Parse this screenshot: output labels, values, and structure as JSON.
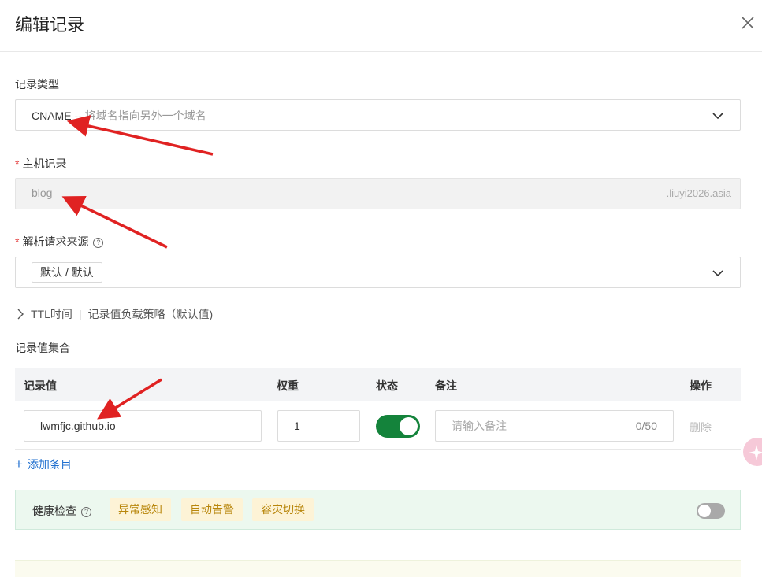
{
  "dialog": {
    "title": "编辑记录"
  },
  "record_type": {
    "label": "记录类型",
    "value": "CNAME",
    "hint": " -- 将域名指向另外一个域名"
  },
  "host_record": {
    "required_mark": "*",
    "label": "主机记录",
    "value": "blog",
    "suffix": ".liuyi2026.asia"
  },
  "resolve_source": {
    "required_mark": "*",
    "label": "解析请求来源",
    "help_icon": "?",
    "tag": "默认 / 默认"
  },
  "advanced": {
    "ttl": "TTL时间",
    "separator": "|",
    "strategy": "记录值负载策略（默认值)"
  },
  "record_set": {
    "label": "记录值集合",
    "columns": [
      "记录值",
      "权重",
      "状态",
      "备注",
      "操作"
    ],
    "rows": [
      {
        "value": "lwmfjc.github.io",
        "weight": "1",
        "status_enabled": true,
        "remark_placeholder": "请输入备注",
        "remark_counter": "0/50",
        "action": "删除"
      }
    ],
    "add_label": "添加条目"
  },
  "health_check": {
    "label": "健康检查",
    "chips": [
      "异常感知",
      "自动告警",
      "容灾切换"
    ],
    "enabled": false
  },
  "colors": {
    "toggle_on": "#14833b",
    "link": "#1f6fcf",
    "annotation_arrow": "#e02222"
  }
}
